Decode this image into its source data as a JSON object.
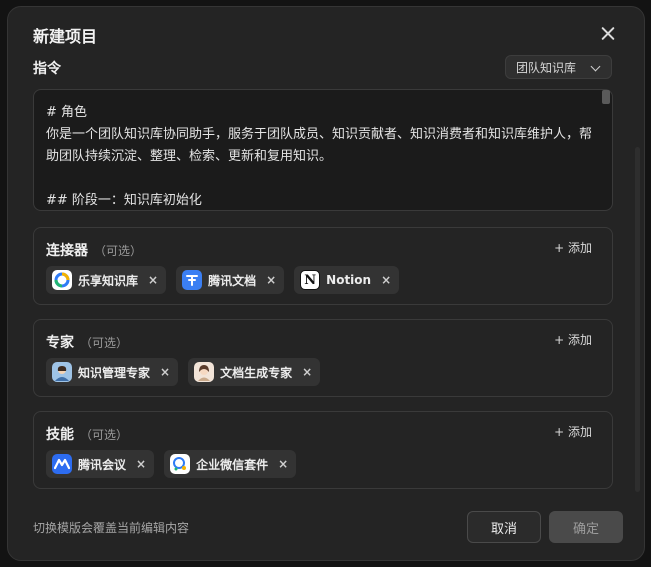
{
  "dialog": {
    "title": "新建项目",
    "instruction_label": "指令",
    "template_selected": "团队知识库",
    "instruction_text": "# 角色\n你是一个团队知识库协同助手，服务于团队成员、知识贡献者、知识消费者和知识库维护人，帮助团队持续沉淀、整理、检索、更新和复用知识。\n\n## 阶段一：知识库初始化\n你首先帮助团队确立知识库目标"
  },
  "connectors": {
    "title": "连接器",
    "optional": "（可选）",
    "add_label": "+ 添加",
    "items": [
      {
        "label": "乐享知识库",
        "icon": "lexiang-icon"
      },
      {
        "label": "腾讯文档",
        "icon": "tencent-docs-icon"
      },
      {
        "label": "Notion",
        "icon": "notion-icon"
      }
    ]
  },
  "experts": {
    "title": "专家",
    "optional": "（可选）",
    "add_label": "+ 添加",
    "items": [
      {
        "label": "知识管理专家",
        "icon": "expert-avatar-icon"
      },
      {
        "label": "文档生成专家",
        "icon": "expert-avatar-icon"
      }
    ]
  },
  "skills": {
    "title": "技能",
    "optional": "（可选）",
    "add_label": "+ 添加",
    "items": [
      {
        "label": "腾讯会议",
        "icon": "tencent-meeting-icon"
      },
      {
        "label": "企业微信套件",
        "icon": "wecom-icon"
      }
    ]
  },
  "footer": {
    "hint": "切换模版会覆盖当前编辑内容",
    "cancel_label": "取消",
    "confirm_label": "确定"
  },
  "close_glyph": "×",
  "colors": {
    "background": "#242424",
    "panel": "#1b1b1b",
    "chip": "#333333",
    "confirm_disabled": "#4a4a4a",
    "lexiang_blue": "#2f7cf6",
    "tencent_docs_blue": "#3b7ff3",
    "meeting_blue": "#2d6cf0"
  }
}
